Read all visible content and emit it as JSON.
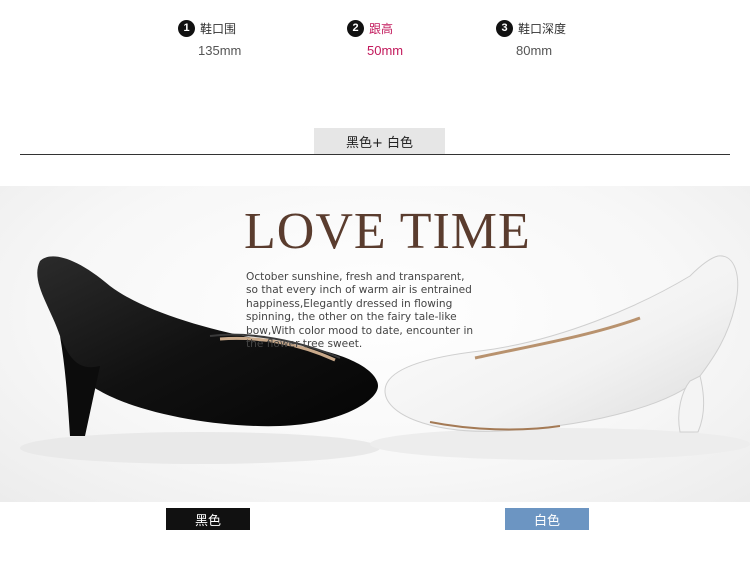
{
  "specs": [
    {
      "num": "1",
      "label": "鞋口围",
      "value": "135mm"
    },
    {
      "num": "2",
      "label": "跟高",
      "value": "50mm"
    },
    {
      "num": "3",
      "label": "鞋口深度",
      "value": "80mm"
    }
  ],
  "color_tag": "黑色+ 白色",
  "banner": {
    "title": "LOVE TIME",
    "lines": [
      "October sunshine, fresh and transparent,",
      "so that every inch of warm air is entrained",
      "happiness,Elegantly dressed in flowing",
      "spinning, the other on the fairy tale-like",
      "bow,With color mood to date, encounter in",
      "the flower tree sweet."
    ]
  },
  "swatches": {
    "black": "黑色",
    "white": "白色"
  },
  "colors": {
    "accent": "#c2185b",
    "title": "#5a3c2e",
    "white_tag": "#6c95c2"
  }
}
